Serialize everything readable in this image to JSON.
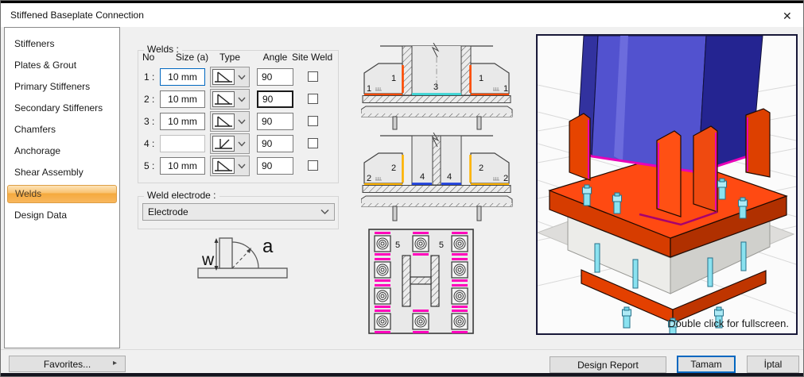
{
  "window": {
    "title": "Stiffened Baseplate Connection",
    "close_icon": "✕"
  },
  "sidebar": {
    "items": [
      {
        "label": "Stiffeners",
        "selected": false
      },
      {
        "label": "Plates & Grout",
        "selected": false
      },
      {
        "label": "Primary Stiffeners",
        "selected": false
      },
      {
        "label": "Secondary Stiffeners",
        "selected": false
      },
      {
        "label": "Chamfers",
        "selected": false
      },
      {
        "label": "Anchorage",
        "selected": false
      },
      {
        "label": "Shear Assembly",
        "selected": false
      },
      {
        "label": "Welds",
        "selected": true
      },
      {
        "label": "Design Data",
        "selected": false
      }
    ]
  },
  "welds_group": {
    "title": "Welds :",
    "columns": {
      "no": "No",
      "size": "Size (a)",
      "type": "Type",
      "angle": "Angle",
      "site_weld": "Site Weld"
    },
    "rows": [
      {
        "no": "1 :",
        "size": "10 mm",
        "type": "fillet",
        "angle": "90",
        "site_weld": false
      },
      {
        "no": "2 :",
        "size": "10 mm",
        "type": "fillet",
        "angle": "90",
        "site_weld": false
      },
      {
        "no": "3 :",
        "size": "10 mm",
        "type": "fillet",
        "angle": "90",
        "site_weld": false
      },
      {
        "no": "4 :",
        "size": "",
        "type": "bevel",
        "angle": "90",
        "site_weld": false
      },
      {
        "no": "5 :",
        "size": "10 mm",
        "type": "fillet",
        "angle": "90",
        "site_weld": false
      }
    ]
  },
  "electrode_group": {
    "title": "Weld electrode :",
    "value": "Electrode"
  },
  "weld_symbol": {
    "w_label": "w",
    "a_label": "a"
  },
  "diagrams": {
    "labels": {
      "w1": "1",
      "w2": "2",
      "w3": "3",
      "w4": "4",
      "w5": "5"
    }
  },
  "preview": {
    "caption": "Double click for fullscreen."
  },
  "footer": {
    "favorites": "Favorites...",
    "favorites_arrow": "▸",
    "design_report": "Design Report",
    "ok": "Tamam",
    "cancel": "İptal"
  },
  "colors": {
    "focus_blue": "#0067c0",
    "selected_tab_orange": "#f5a93d",
    "weld1_orange": "#ff4a00",
    "weld2_amber": "#ffb400",
    "weld3_cyan": "#3fd4d4",
    "weld4_blue": "#2244dd",
    "weld5_magenta": "#ff00bb",
    "column_blue": "#4f4fd2",
    "plate_orange": "#ff4a12",
    "bolt_cyan": "#8ae2f0"
  }
}
